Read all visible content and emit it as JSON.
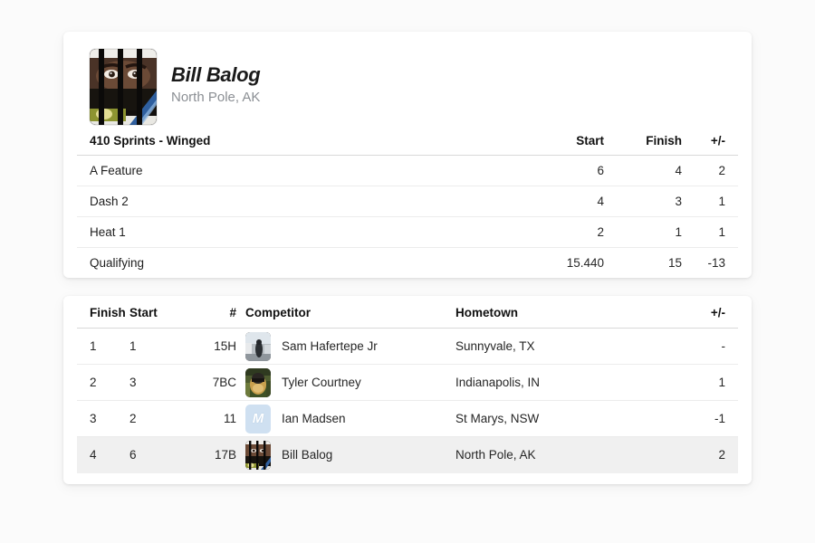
{
  "profile": {
    "name": "Bill Balog",
    "hometown": "North Pole, AK",
    "avatar_alt": "driver-photo"
  },
  "stats": {
    "title": "410 Sprints - Winged",
    "columns": [
      "Start",
      "Finish",
      "+/-"
    ],
    "rows": [
      {
        "name": "A Feature",
        "start": "6",
        "finish": "4",
        "plus_minus": "2"
      },
      {
        "name": "Dash 2",
        "start": "4",
        "finish": "3",
        "plus_minus": "1"
      },
      {
        "name": "Heat 1",
        "start": "2",
        "finish": "1",
        "plus_minus": "1"
      },
      {
        "name": "Qualifying",
        "start": "15.440",
        "finish": "15",
        "plus_minus": "-13"
      }
    ]
  },
  "results": {
    "columns": {
      "finish": "Finish",
      "start": "Start",
      "number": "#",
      "competitor": "Competitor",
      "hometown": "Hometown",
      "plus_minus": "+/-"
    },
    "rows": [
      {
        "finish": "1",
        "start": "1",
        "number": "15H",
        "competitor": "Sam Hafertepe Jr",
        "hometown": "Sunnyvale, TX",
        "plus_minus": "-",
        "avatar": "photo-hafertepe",
        "highlight": false
      },
      {
        "finish": "2",
        "start": "3",
        "number": "7BC",
        "competitor": "Tyler Courtney",
        "hometown": "Indianapolis, IN",
        "plus_minus": "1",
        "avatar": "photo-courtney",
        "highlight": false
      },
      {
        "finish": "3",
        "start": "2",
        "number": "11",
        "competitor": "Ian Madsen",
        "hometown": "St Marys, NSW",
        "plus_minus": "-1",
        "avatar": "initial-M",
        "highlight": false
      },
      {
        "finish": "4",
        "start": "6",
        "number": "17B",
        "competitor": "Bill Balog",
        "hometown": "North Pole, AK",
        "plus_minus": "2",
        "avatar": "photo-balog",
        "highlight": true
      }
    ]
  },
  "colors": {
    "page_background": "#fbfbfb",
    "card_background": "#ffffff",
    "text_primary": "#262626",
    "text_muted": "#8b8f94",
    "divider": "#ececec",
    "header_divider": "#d9d9d9",
    "row_highlight": "#f0f0f0",
    "avatar_placeholder": "#cfe0f1"
  }
}
